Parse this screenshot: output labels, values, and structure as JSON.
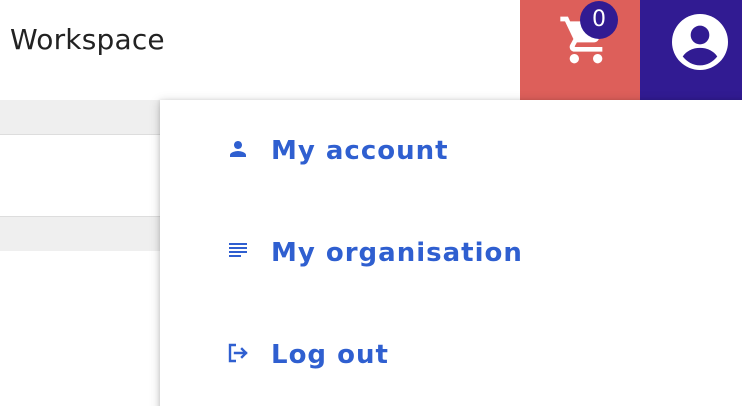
{
  "header": {
    "title": "Workspace",
    "cart": {
      "count": "0",
      "icon": "shopping-cart-icon",
      "background": "#dd5f5a",
      "badge_color": "#311b92"
    },
    "account": {
      "icon": "account-circle-icon",
      "background": "#311b92"
    }
  },
  "menu": {
    "text_color": "#2f5fd0",
    "items": [
      {
        "label": "My account",
        "icon": "person-icon"
      },
      {
        "label": "My organisation",
        "icon": "notes-icon"
      },
      {
        "label": "Log out",
        "icon": "logout-icon"
      }
    ]
  }
}
